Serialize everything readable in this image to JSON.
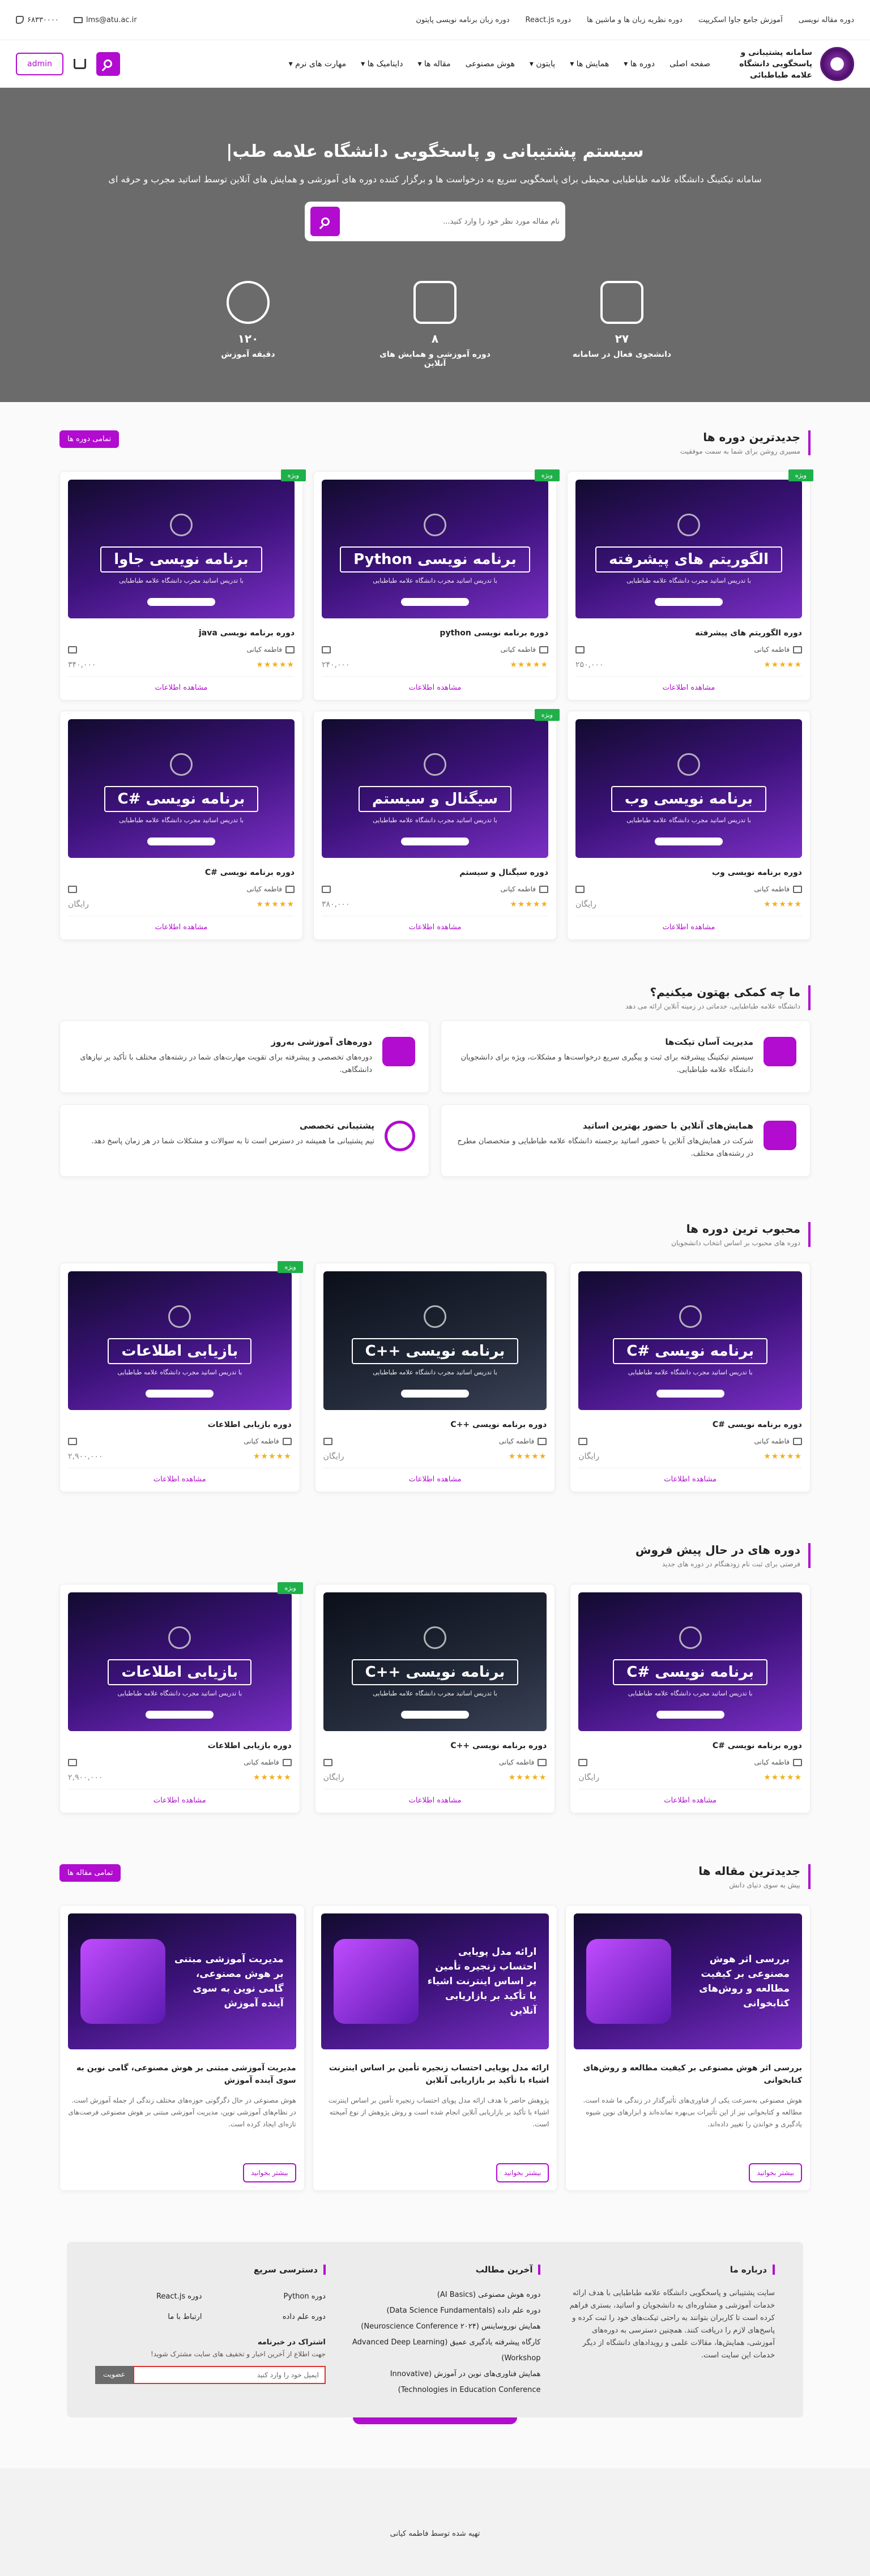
{
  "topbar": {
    "links": [
      "دوره مقاله نویسی",
      "آموزش جامع جاوا اسکریپت",
      "دوره نظریه زبان ها و ماشین ها",
      "دوره React.js",
      "دوره زبان برنامه نویسی پایتون"
    ],
    "email": "lms@atu.ac.ir",
    "phone": "۶۸۳۳۰۰۰۰"
  },
  "nav": {
    "brand": "سامانه پشتیبانی و پاسخگویی دانشگاه علامه طباطبائی",
    "menu": [
      "صفحه اصلی",
      "دوره ها ▾",
      "همایش ها ▾",
      "پایتون ▾",
      "هوش مصنوعی",
      "مقاله ها ▾",
      "داینامیک ها ▾",
      "مهارت های نرم ▾"
    ],
    "admin": "admin"
  },
  "hero": {
    "title": "سیستم پشتیبانی و پاسخگویی دانشگاه علامه طب|",
    "desc": "سامانه تیکتینگ دانشگاه علامه طباطبایی محیطی برای پاسخگویی سریع به درخواست ها و برگزار کننده دوره های آموزشی و همایش های آنلاین توسط اساتید مجرب و حرفه ای",
    "search_placeholder": "نام مقاله مورد نظر خود را وارد کنید...",
    "stats": [
      {
        "value": "۲۷",
        "label": "دانشجوی فعال در سامانه"
      },
      {
        "value": "۸",
        "label": "دوره آموزشی و همایش های آنلاین"
      },
      {
        "value": "۱۲۰",
        "label": "دقیقه آموزش"
      }
    ]
  },
  "latest": {
    "title": "جدیدترین دوره ها",
    "subtitle": "مسیری روشن برای شما به سمت موفقیت",
    "all": "تمامی دوره ها",
    "cards": [
      {
        "title": "الگوریتم های پیشرفته",
        "name": "دوره الگوریتم های پیشرفته",
        "teacher": "فاطمه کیانی",
        "price": "۲۵۰,۰۰۰",
        "badge": "ویژه",
        "dark": false
      },
      {
        "title": "برنامه نویسی Python",
        "name": "دوره برنامه نویسی python",
        "teacher": "فاطمه کیانی",
        "price": "۲۴۰,۰۰۰",
        "badge": "ویژه",
        "dark": false
      },
      {
        "title": "برنامه نویسی جاوا",
        "name": "دوره برنامه نویسی java",
        "teacher": "فاطمه کیانی",
        "price": "۳۴۰,۰۰۰",
        "badge": "ویژه",
        "dark": false
      },
      {
        "title": "برنامه نویسی وب",
        "name": "دوره برنامه نویسی وب",
        "teacher": "فاطمه کیانی",
        "price": "رایگان",
        "badge": "",
        "dark": false
      },
      {
        "title": "سیگنال و سیستم",
        "name": "دوره سیگنال و سیستم",
        "teacher": "فاطمه کیانی",
        "price": "۳۸۰,۰۰۰",
        "badge": "ویژه",
        "dark": false
      },
      {
        "title": "برنامه نویسی #C",
        "name": "دوره برنامه نویسی #C",
        "teacher": "فاطمه کیانی",
        "price": "رایگان",
        "badge": "",
        "dark": false
      }
    ]
  },
  "more_label": "مشاهده اطلاعات",
  "card_sub": "با تدریس اساتید مجرب دانشگاه علامه طباطبایی",
  "help": {
    "title": "ما چه کمکی بهتون میکنیم؟",
    "subtitle": "دانشگاه علامه طباطبایی، خدماتی در زمینه آنلاین ارائه می دهد",
    "items": [
      {
        "title": "مدیریت آسان تیکت‌ها",
        "desc": "سیستم تیکتینگ پیشرفته برای ثبت و پیگیری سریع درخواست‌ها و مشکلات، ویژه برای دانشجویان دانشگاه علامه طباطبایی."
      },
      {
        "title": "دوره‌های آموزشی به‌روز",
        "desc": "دوره‌های تخصصی و پیشرفته برای تقویت مهارت‌های شما در رشته‌های مختلف با تأکید بر نیازهای دانشگاهی."
      },
      {
        "title": "همایش‌های آنلاین با حضور بهترین اساتید",
        "desc": "شرکت در همایش‌های آنلاین با حضور اساتید برجسته دانشگاه علامه طباطبایی و متخصصان مطرح در رشته‌های مختلف."
      },
      {
        "title": "پشتیبانی تخصصی",
        "desc": "تیم پشتیبانی ما همیشه در دسترس است تا به سوالات و مشکلات شما در هر زمان پاسخ دهد."
      }
    ]
  },
  "popular": {
    "title": "محبوب ترین دوره ها",
    "subtitle": "دوره های محبوب بر اساس انتخاب دانشجویان",
    "cards": [
      {
        "title": "برنامه نویسی #C",
        "name": "دوره برنامه نویسی #C",
        "teacher": "فاطمه کیانی",
        "price": "رایگان",
        "badge": "",
        "dark": false
      },
      {
        "title": "برنامه نویسی ++C",
        "name": "دوره برنامه نویسی ++C",
        "teacher": "فاطمه کیانی",
        "price": "رایگان",
        "badge": "",
        "dark": true
      },
      {
        "title": "بازیابی اطلاعات",
        "name": "دوره بازیابی اطلاعات",
        "teacher": "فاطمه کیانی",
        "price": "۲,۹۰۰,۰۰۰",
        "badge": "ویژه",
        "dark": false
      }
    ]
  },
  "presale": {
    "title": "دوره های در حال پیش فروش",
    "subtitle": "فرصتی برای ثبت نام زودهنگام در دوره های جدید",
    "cards": [
      {
        "title": "برنامه نویسی #C",
        "name": "دوره برنامه نویسی #C",
        "teacher": "فاطمه کیانی",
        "price": "رایگان",
        "badge": "",
        "dark": false
      },
      {
        "title": "برنامه نویسی ++C",
        "name": "دوره برنامه نویسی ++C",
        "teacher": "فاطمه کیانی",
        "price": "رایگان",
        "badge": "",
        "dark": true
      },
      {
        "title": "بازیابی اطلاعات",
        "name": "دوره بازیابی اطلاعات",
        "teacher": "فاطمه کیانی",
        "price": "۲,۹۰۰,۰۰۰",
        "badge": "ویژه",
        "dark": false
      }
    ]
  },
  "articles": {
    "title": "جدیدترین مقاله ها",
    "subtitle": "بیش به سوی دنیای دانش",
    "all": "تمامی مقاله ها",
    "read": "بیشتر بخوانید",
    "items": [
      {
        "thumb": "بررسی اثر هوش مصنوعی بر کیفیت مطالعه و روش‌های کتابخوانی",
        "title": "بررسی اثر هوش مصنوعی بر کیفیت مطالعه و روش‌های کتابخوانی",
        "desc": "هوش مصنوعی به‌سرعت یکی از فناوری‌های تأثیرگذار در زندگی ما شده است. مطالعه و کتابخوانی نیز از این تأثیرات بی‌بهره نمانده‌اند و ابزارهای نوین شیوه یادگیری و خواندن را تغییر داده‌اند."
      },
      {
        "thumb": "ارائه مدل پویایی احتساب زنجیره تأمین بر اساس اینترنت اشیاء با تأکید بر بازاریابی آنلاین",
        "title": "ارائه مدل پویایی احتساب زنجیره تأمین بر اساس اینترنت اشیاء با تأکید بر بازاریابی آنلاین",
        "desc": "پژوهش حاضر با هدف ارائه مدل پویای احتساب زنجیره تأمین بر اساس اینترنت اشیاء با تأکید بر بازاریابی آنلاین انجام شده است و روش پژوهش از نوع آمیخته است."
      },
      {
        "thumb": "مدیریت آموزشی مبتنی بر هوش مصنوعی، گامی نوین به سوی آینده آموزش",
        "title": "مدیریت آموزشی مبتنی بر هوش مصنوعی، گامی نوین به سوی آینده آموزش",
        "desc": "هوش مصنوعی در حال دگرگونی حوزه‌های مختلف زندگی از جمله آموزش است. در نظام‌های آموزشی نوین، مدیریت آموزشی مبتنی بر هوش مصنوعی فرصت‌های تازه‌ای ایجاد کرده است."
      }
    ]
  },
  "footer": {
    "about_title": "درباره ما",
    "about": "سایت پشتیبانی و پاسخگویی دانشگاه علامه طباطبایی با هدف ارائه خدمات آموزشی و مشاوره‌ای به دانشجویان و اساتید، بستری فراهم کرده است تا کاربران بتوانند به راحتی تیکت‌های خود را ثبت کرده و پاسخ‌های لازم را دریافت کنند. همچنین دسترسی به دوره‌های آموزشی، همایش‌ها، مقالات علمی و رویدادهای دانشگاه از دیگر خدمات این سایت است.",
    "latest_title": "آخرین مطالب",
    "latest": [
      "دوره هوش مصنوعی (AI Basics)",
      "دوره علم داده (Data Science Fundamentals)",
      "همایش نوروساینس (Neuroscience Conference ۲۰۲۴)",
      "کارگاه پیشرفته یادگیری عمیق (Advanced Deep Learning Workshop)",
      "همایش فناوری‌های نوین در آموزش (Innovative Technologies in Education Conference)"
    ],
    "quick_title": "دسترسی سریع",
    "quick": [
      "دوره Python",
      "دوره React.js",
      "دوره علم داده",
      "ارتباط با ما"
    ],
    "newsletter": "اشتراک در خبرنامه",
    "newsletter_desc": "جهت اطلاع از آخرین اخبار و تخفیف های سایت مشترک شوید!",
    "email_placeholder": "ایمیل خود را وارد کنید",
    "subscribe": "عضویت"
  },
  "copyright": "تهیه شده توسط فاطمه کیانی"
}
